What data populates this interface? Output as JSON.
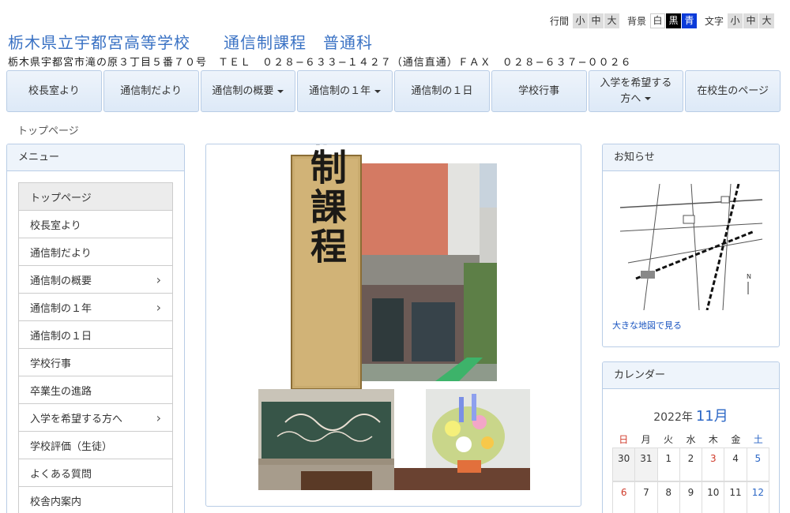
{
  "a11y": {
    "line_spacing_label": "行間",
    "line_spacing_options": [
      "小",
      "中",
      "大"
    ],
    "background_label": "背景",
    "background_options": [
      "白",
      "黒",
      "青"
    ],
    "text_label": "文字",
    "text_options": [
      "小",
      "中",
      "大"
    ]
  },
  "header": {
    "title": "栃木県立宇都宮高等学校　　通信制課程　普通科",
    "address": "栃木県宇都宮市滝の原３丁目５番７０号　ＴＥＬ　０２８−６３３−１４２７（通信直通）ＦＡＸ　０２８−６３７−００２６"
  },
  "nav": {
    "items": [
      {
        "label": "校長室より"
      },
      {
        "label": "通信制だより"
      },
      {
        "label": "通信制の概要"
      },
      {
        "label": "通信制の１年"
      },
      {
        "label": "通信制の１日"
      },
      {
        "label": "学校行事"
      },
      {
        "label_line1": "入学を希望する",
        "label_line2": "方へ"
      },
      {
        "label": "在校生のページ"
      }
    ]
  },
  "breadcrumb": "トップページ",
  "menu": {
    "title": "メニュー",
    "items": [
      "トップページ",
      "校長室より",
      "通信制だより",
      "通信制の概要",
      "通信制の１年",
      "通信制の１日",
      "学校行事",
      "卒業生の進路",
      "入学を希望する方へ",
      "学校評価（生徒）",
      "よくある質問",
      "校舎内案内"
    ]
  },
  "main_image": {
    "sign_text": "通信制課程"
  },
  "notice": {
    "title": "お知らせ",
    "map_link": "大きな地図で見る"
  },
  "calendar": {
    "title": "カレンダー",
    "year": "2022年",
    "month": "11月",
    "dow": [
      "日",
      "月",
      "火",
      "水",
      "木",
      "金",
      "土"
    ],
    "week1": [
      "30",
      "31",
      "1",
      "2",
      "3",
      "4",
      "5"
    ],
    "week2": [
      "6",
      "7",
      "8",
      "9",
      "10",
      "11",
      "12"
    ]
  },
  "colors": {
    "accent": "#3a72c4",
    "nav_bg": "#dde9f7",
    "border": "#b9cde6"
  }
}
